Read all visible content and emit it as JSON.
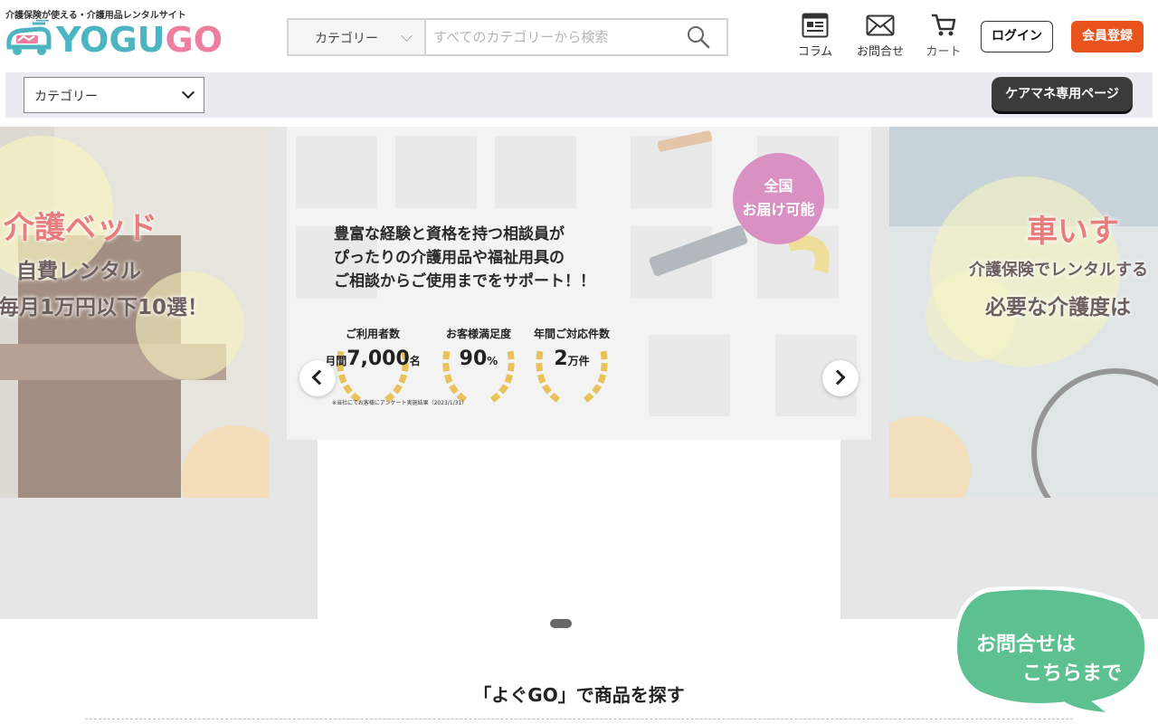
{
  "header": {
    "tagline": "介護保険が使える・介護用品レンタルサイト",
    "logo": {
      "part1": "YOGU",
      "part2": "GO"
    },
    "search": {
      "category_label": "カテゴリー",
      "placeholder": "すべてのカテゴリーから検索"
    },
    "nav": [
      {
        "label": "コラム",
        "icon": "column-icon"
      },
      {
        "label": "お問合せ",
        "icon": "mail-icon"
      },
      {
        "label": "カート",
        "icon": "cart-icon"
      }
    ],
    "login_label": "ログイン",
    "register_label": "会員登録"
  },
  "catbar": {
    "category_label": "カテゴリー",
    "caremane_label": "ケアマネ専用ページ"
  },
  "carousel": {
    "left_slide": {
      "title": "介護ベッド",
      "line1": "自費レンタル",
      "line2": "毎月1万円以下10選！"
    },
    "center_slide": {
      "lines": [
        "豊富な経験と資格を持つ相談員が",
        "ぴったりの介護用品や福祉用具の",
        "ご相談からご使用までをサポート！！"
      ],
      "badge_line1": "全国",
      "badge_line2": "お届け可能",
      "stats": [
        {
          "label": "ご利用者数",
          "prefix": "月間",
          "value": "7,000",
          "unit": "名"
        },
        {
          "label": "お客様満足度",
          "prefix": "",
          "value": "90",
          "unit": "%"
        },
        {
          "label": "年間ご対応件数",
          "prefix": "",
          "value": "2",
          "unit": "万件"
        }
      ],
      "note": "※当社にてお客様にアンケート実施結果（2023/1/31）"
    },
    "right_slide": {
      "title": "車いす",
      "line1": "介護保険でレンタルする",
      "line2": "必要な介護度は"
    }
  },
  "section": {
    "title": "「よぐGO」で商品を探す"
  },
  "contact_bubble": {
    "line1": "お問合せは",
    "line2": "こちらまで"
  },
  "colors": {
    "accent_orange": "#e8531b",
    "logo_teal": "#4cb5c1",
    "logo_pink": "#ee7e9e",
    "badge_pink": "#d891c2",
    "bubble_green": "#5cc090"
  }
}
